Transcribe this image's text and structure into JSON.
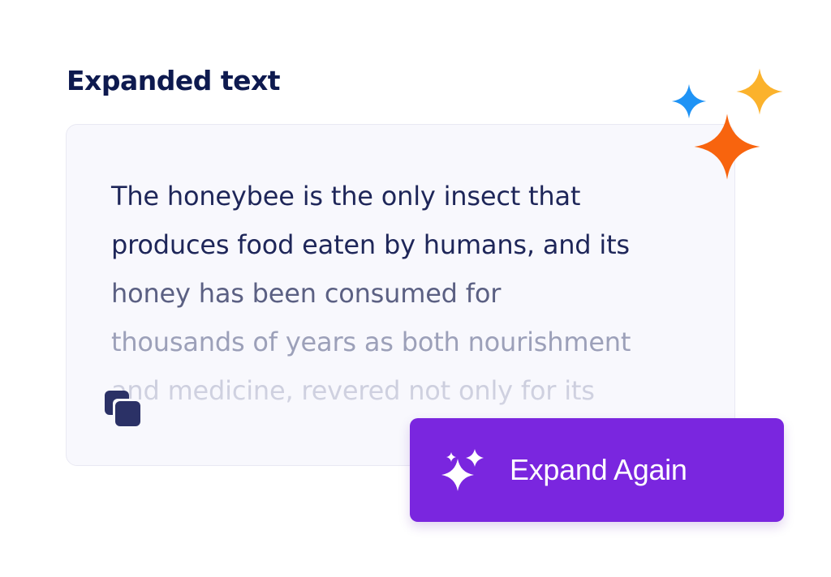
{
  "heading": "Expanded text",
  "expanded_text": {
    "lines": [
      "The honeybee is the only insect that",
      "produces food eaten by humans, and its",
      "honey has been consumed for",
      "thousands of years as both nourishment",
      "and medicine, revered not only for its"
    ]
  },
  "copy_button": {
    "icon": "copy-icon"
  },
  "expand_button": {
    "label": "Expand Again",
    "icon": "sparkles-icon",
    "color": "#7a26df"
  },
  "decorations": {
    "sparkle_colors": [
      "#1f93f5",
      "#fbb22c",
      "#f8640e"
    ]
  }
}
